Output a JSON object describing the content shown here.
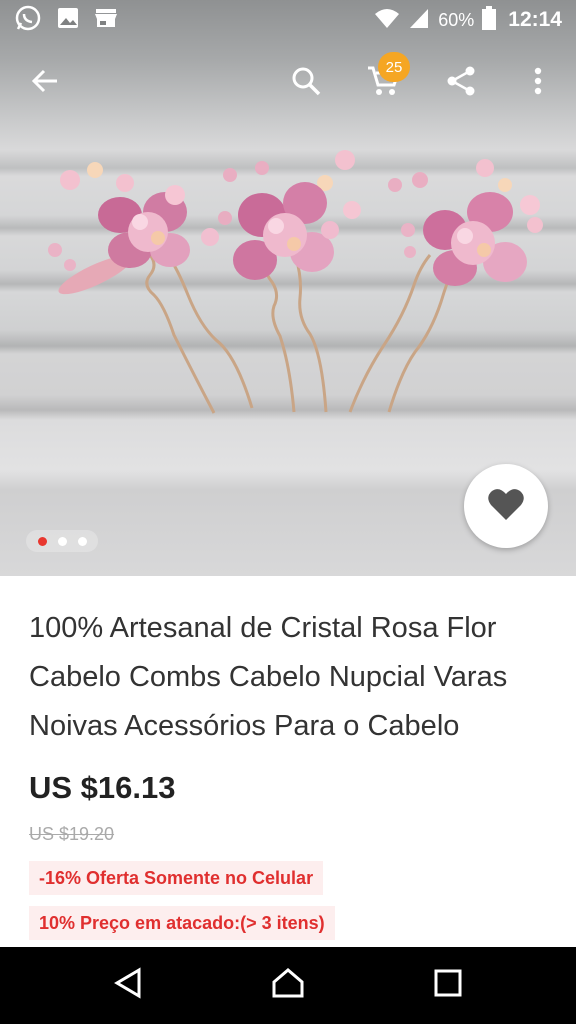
{
  "status_bar": {
    "battery_percent": "60%",
    "time": "12:14",
    "left_icons": [
      "whatsapp-icon",
      "image-icon",
      "store-icon"
    ],
    "right_icons": [
      "wifi-icon",
      "signal-icon",
      "battery-icon"
    ]
  },
  "toolbar": {
    "icons": [
      "back-arrow-icon",
      "search-icon",
      "cart-icon",
      "share-icon",
      "more-vert-icon"
    ],
    "cart_count": "25",
    "badge_color": "#f5a623"
  },
  "gallery": {
    "image_count": 3,
    "active_index": 0,
    "active_dot_color": "#e8372f",
    "wishlist_icon": "heart-icon"
  },
  "product": {
    "title": "100% Artesanal de Cristal Rosa Flor Cabelo Combs Cabelo Nupcial Varas Noivas Acessórios Para o Cabelo",
    "price": "US $16.13",
    "original_price": "US $19.20",
    "promo_mobile": "-16%  Oferta Somente no Celular",
    "promo_wholesale": "10%  Preço em atacado:(> 3 itens)",
    "promo_color": "#e02f2f"
  },
  "nav_bar": {
    "icons": [
      "back-triangle-icon",
      "home-icon",
      "recents-icon"
    ]
  }
}
